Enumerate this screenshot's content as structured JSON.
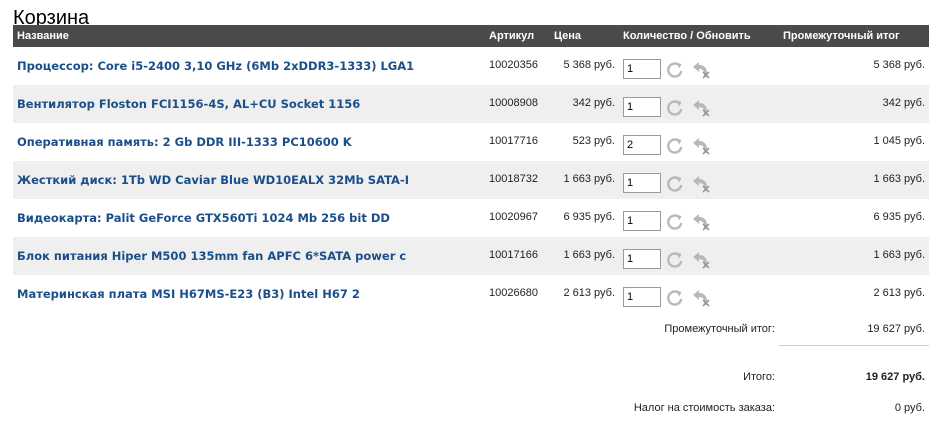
{
  "page_title": "Корзина",
  "columns": {
    "name": "Название",
    "sku": "Артикул",
    "price": "Цена",
    "qty": "Количество / Обновить",
    "subtotal": "Промежуточный итог"
  },
  "items": [
    {
      "name": "Процессор: Core i5-2400 3,10 GHz (6Mb 2xDDR3-1333) LGA1",
      "sku": "10020356",
      "price": "5 368 руб.",
      "qty": "1",
      "subtotal": "5 368 руб."
    },
    {
      "name": "Вентилятор Floston FCI1156-4S, AL+CU Socket 1156",
      "sku": "10008908",
      "price": "342 руб.",
      "qty": "1",
      "subtotal": "342 руб."
    },
    {
      "name": "Оперативная память: 2 Gb DDR III-1333 PC10600 K",
      "sku": "10017716",
      "price": "523 руб.",
      "qty": "2",
      "subtotal": "1 045 руб."
    },
    {
      "name": "Жесткий диск: 1Tb WD Caviar Blue WD10EALX 32Mb SATA-I",
      "sku": "10018732",
      "price": "1 663 руб.",
      "qty": "1",
      "subtotal": "1 663 руб."
    },
    {
      "name": "Видеокарта: Palit GeForce GTX560Ti 1024 Mb 256 bit DD",
      "sku": "10020967",
      "price": "6 935 руб.",
      "qty": "1",
      "subtotal": "6 935 руб."
    },
    {
      "name": "Блок питания Hiper M500 135mm fan APFC 6*SATA power c",
      "sku": "10017166",
      "price": "1 663 руб.",
      "qty": "1",
      "subtotal": "1 663 руб."
    },
    {
      "name": "Материнская плата MSI H67MS-E23 (B3) Intel H67 2",
      "sku": "10026680",
      "price": "2 613 руб.",
      "qty": "1",
      "subtotal": "2 613 руб."
    }
  ],
  "summary": {
    "subtotal_label": "Промежуточный итог:",
    "subtotal_value": "19 627 руб.",
    "total_label": "Итого:",
    "total_value": "19 627 руб.",
    "tax_label": "Налог на стоимость заказа:",
    "tax_value": "0 руб."
  },
  "icons": {
    "refresh": "refresh-icon",
    "remove": "remove-icon"
  },
  "colors": {
    "header_bg": "#4a4a4a",
    "link": "#1b4f8a",
    "alt_row": "#efefef"
  }
}
